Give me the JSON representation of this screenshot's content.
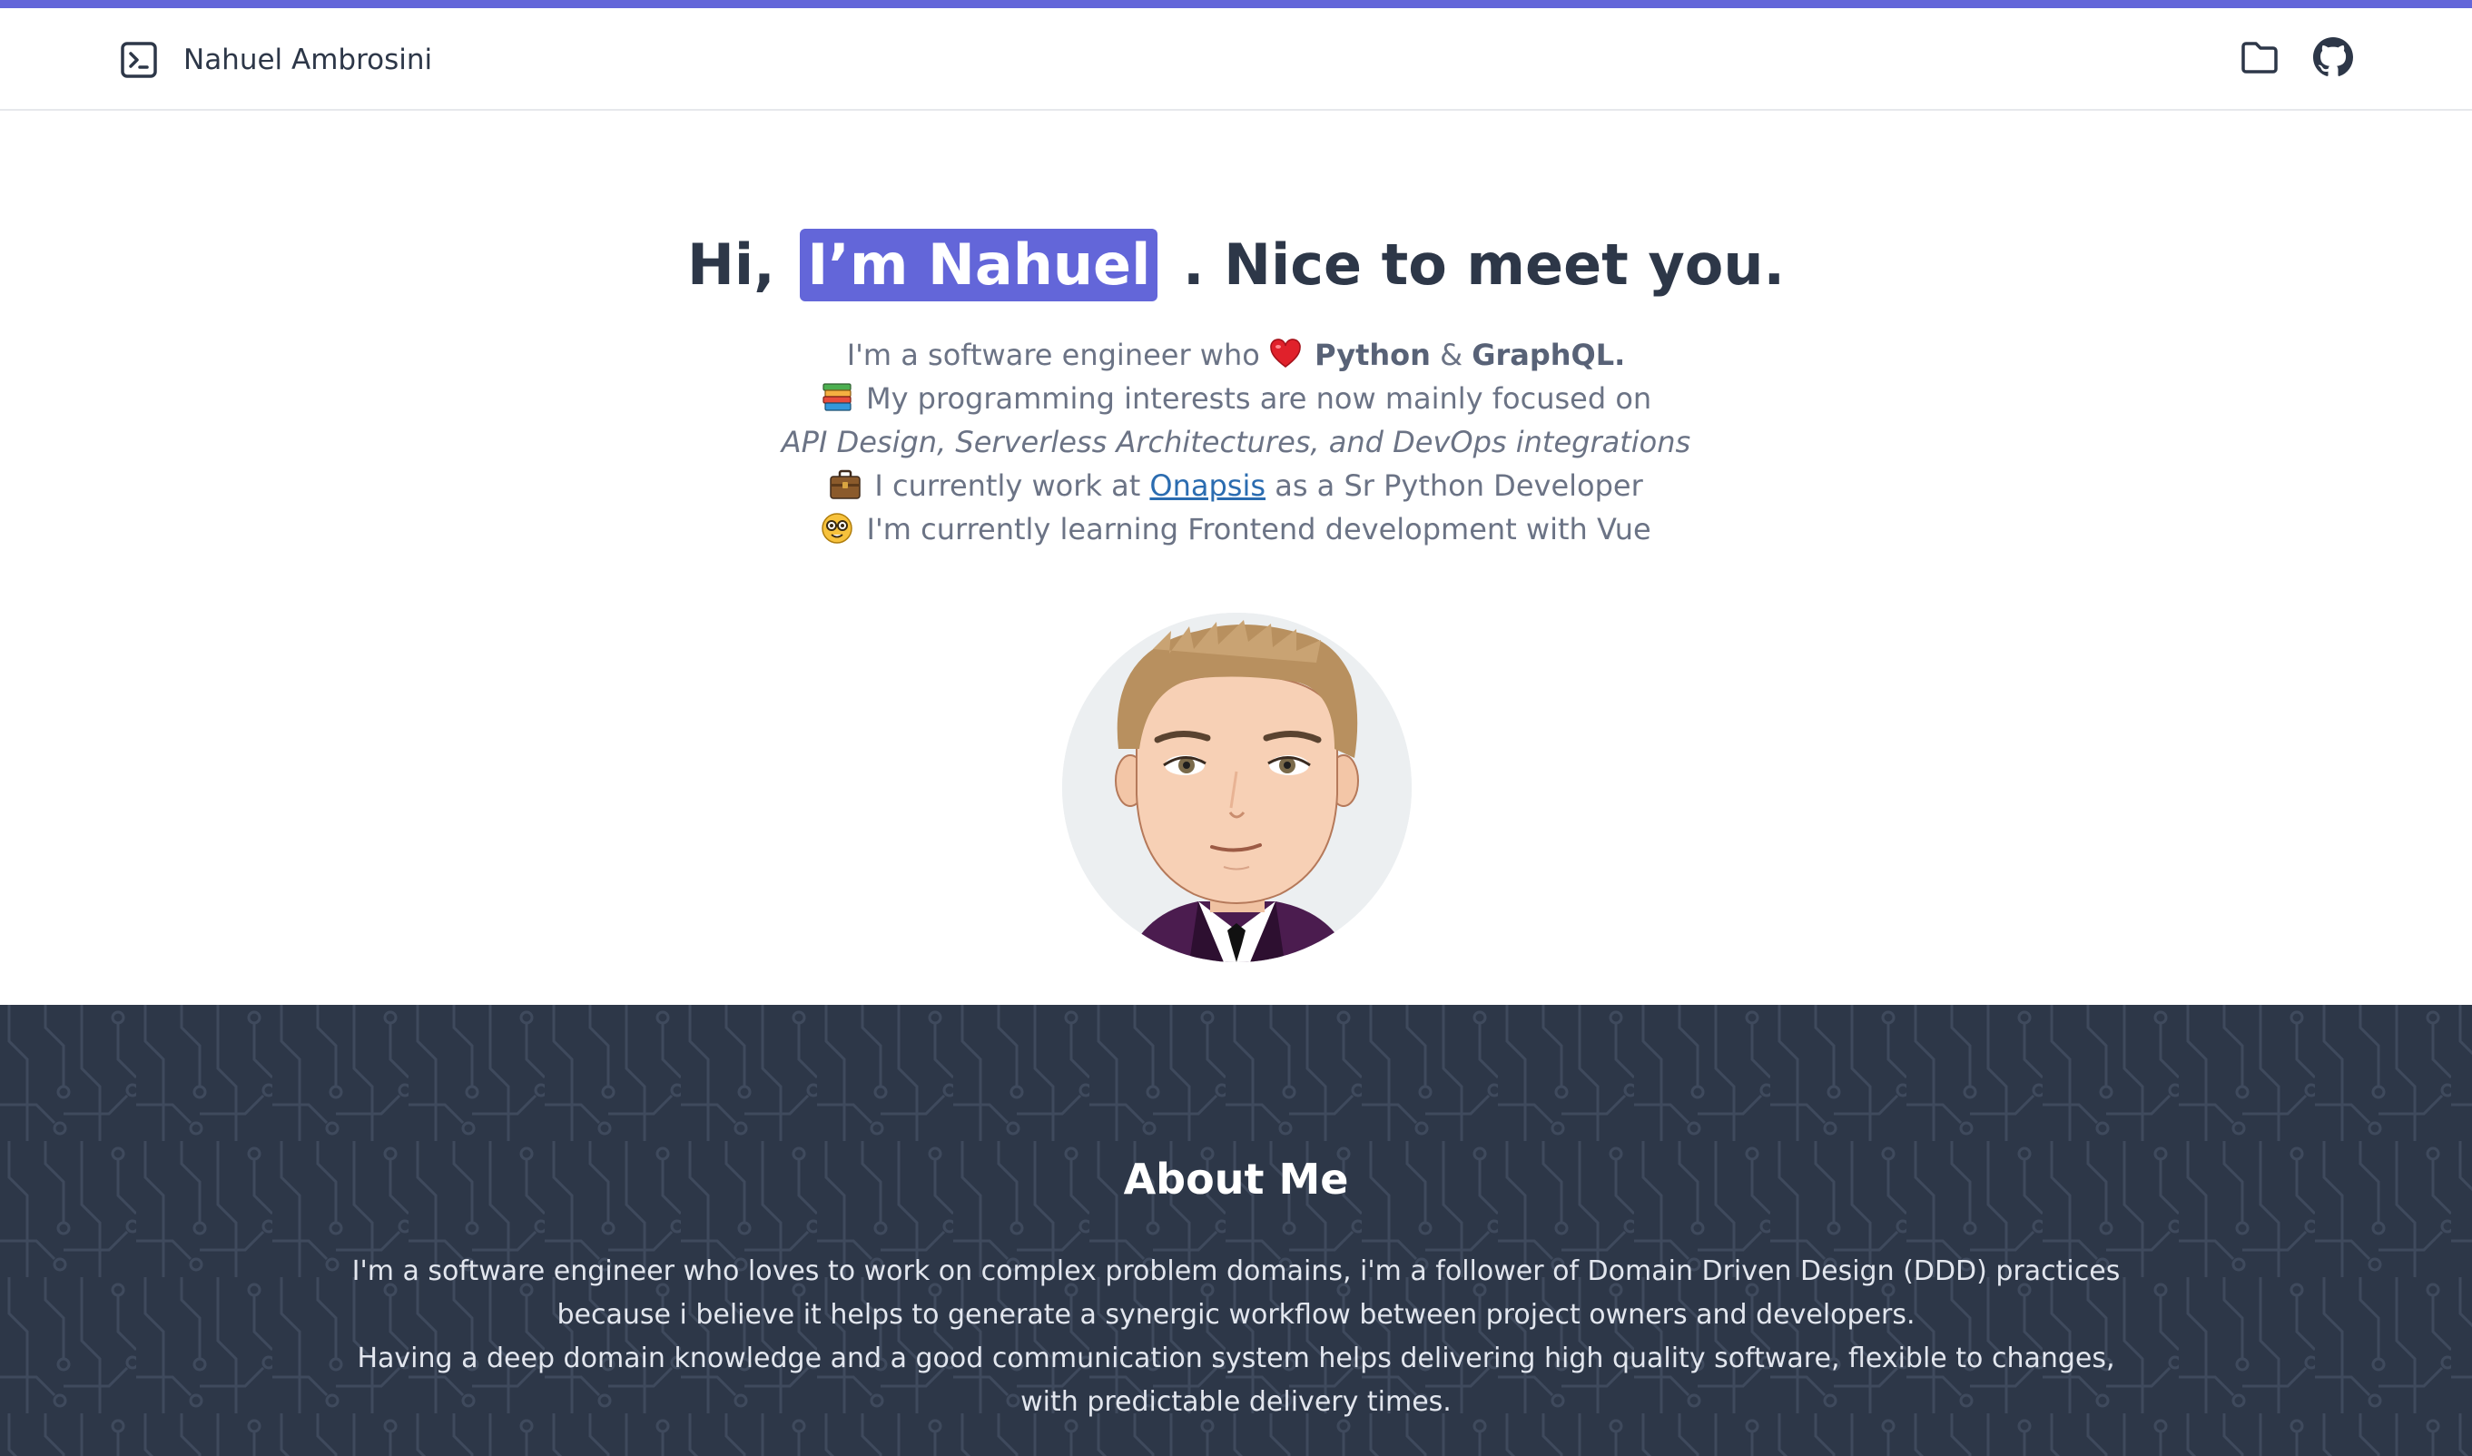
{
  "header": {
    "brand_name": "Nahuel Ambrosini",
    "icons": [
      "terminal-icon",
      "folder-icon",
      "github-icon"
    ]
  },
  "hero": {
    "greeting": "Hi,",
    "highlight": "I’m Nahuel",
    "tagline": ". Nice to meet you.",
    "line1_prefix": "I'm a software engineer who",
    "line1_python": "Python",
    "line1_amp": "&",
    "line1_graphql": "GraphQL.",
    "line2": "My programming interests are now mainly focused on",
    "line3": "API Design, Serverless Architectures, and DevOps integrations",
    "line4_prefix": "I currently work at",
    "line4_link": "Onapsis",
    "line4_suffix": "as a Sr Python Developer",
    "line5": "I'm currently learning Frontend development with Vue",
    "emoji_icons": [
      "heart-icon",
      "books-icon",
      "briefcase-icon",
      "nerd-face-icon"
    ]
  },
  "about": {
    "title": "About Me",
    "paragraph1": "I'm a software engineer who loves to work on complex problem domains, i'm a follower of Domain Driven Design (DDD) practices because i believe it helps to generate a synergic workflow between project owners and developers.",
    "paragraph2": "Having a deep domain knowledge and a good communication system helps delivering high quality software, flexible to changes, with predictable delivery times."
  },
  "colors": {
    "accent": "#6366d9",
    "dark_section": "#2d3748",
    "link": "#2b6cb0"
  }
}
